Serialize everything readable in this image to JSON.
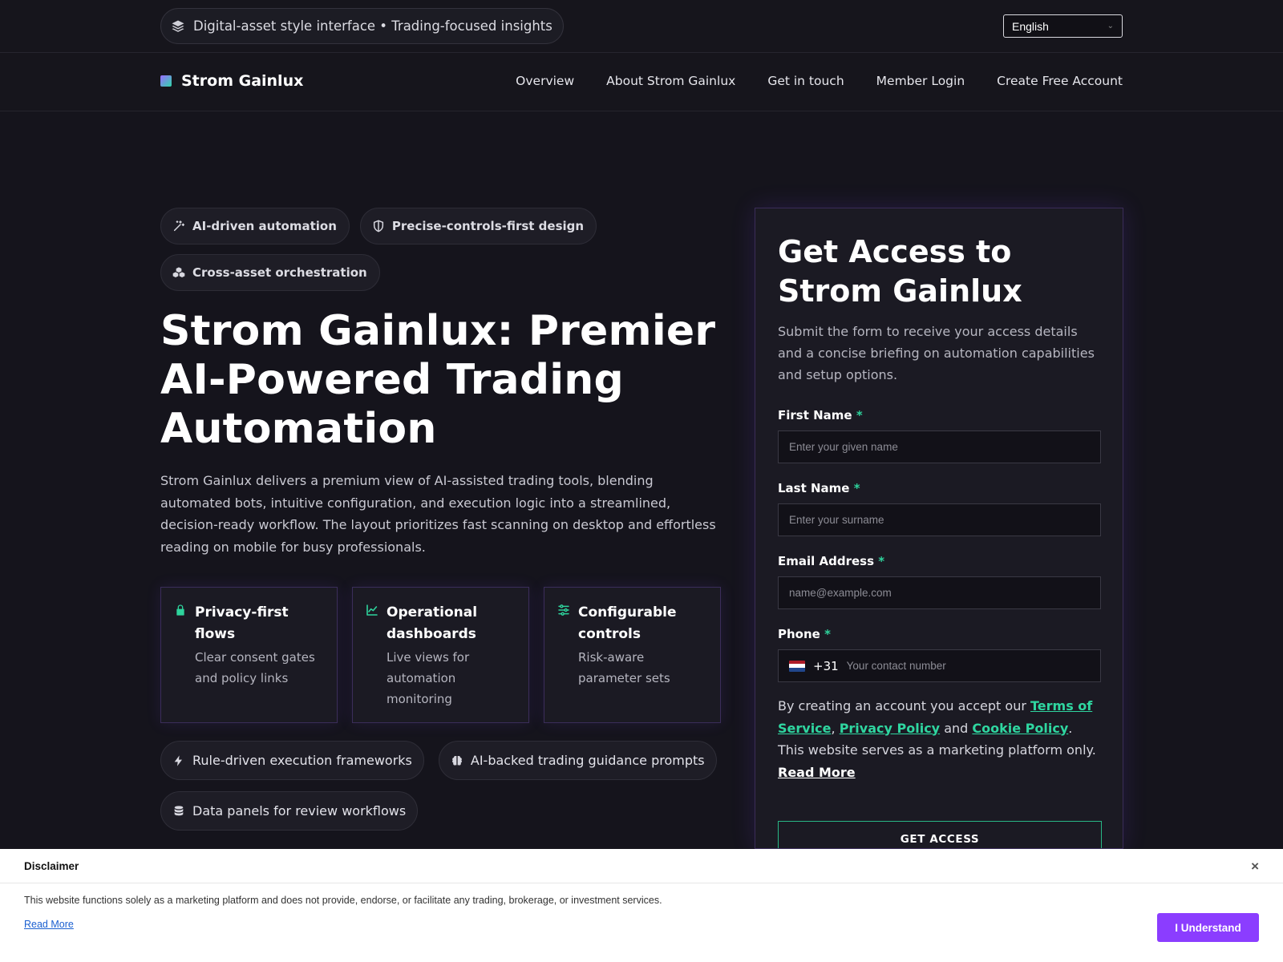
{
  "topbar": {
    "pill_text": "Digital-asset style interface • Trading-focused insights",
    "language": "English"
  },
  "nav": {
    "brand": "Strom Gainlux",
    "links": [
      "Overview",
      "About Strom Gainlux",
      "Get in touch",
      "Member Login",
      "Create Free Account"
    ]
  },
  "hero": {
    "tags": [
      "AI-driven automation",
      "Precise-controls-first design",
      "Cross-asset orchestration"
    ],
    "title": "Strom Gainlux: Premier AI-Powered Trading Automation",
    "description": "Strom Gainlux delivers a premium view of AI-assisted trading tools, blending automated bots, intuitive configuration, and execution logic into a streamlined, decision-ready workflow. The layout prioritizes fast scanning on desktop and effortless reading on mobile for busy professionals.",
    "features": [
      {
        "title": "Privacy-first flows",
        "text": "Clear consent gates and policy links",
        "icon": "lock-icon"
      },
      {
        "title": "Operational dashboards",
        "text": "Live views for automation monitoring",
        "icon": "chart-line-icon"
      },
      {
        "title": "Configurable controls",
        "text": "Risk-aware parameter sets",
        "icon": "sliders-icon"
      }
    ],
    "chips": [
      "Rule-driven execution frameworks",
      "AI-backed trading guidance prompts",
      "Data panels for review workflows"
    ]
  },
  "form": {
    "title": "Get Access to Strom Gainlux",
    "subtitle": "Submit the form to receive your access details and a concise briefing on automation capabilities and setup options.",
    "first_name_label": "First Name",
    "first_name_placeholder": "Enter your given name",
    "last_name_label": "Last Name",
    "last_name_placeholder": "Enter your surname",
    "email_label": "Email Address",
    "email_placeholder": "name@example.com",
    "phone_label": "Phone",
    "phone_code": "+31",
    "phone_placeholder": "Your contact number",
    "required_mark": "*",
    "consent_prefix": "By creating an account you accept our ",
    "terms": "Terms of Service",
    "comma": ", ",
    "privacy": "Privacy Policy",
    "and": " and ",
    "cookie": "Cookie Policy",
    "consent_suffix": ". This website serves as a marketing platform only. ",
    "read_more": "Read More",
    "submit": "GET ACCESS"
  },
  "disclaimer": {
    "title": "Disclaimer",
    "text": "This website functions solely as a marketing platform and does not provide, endorse, or facilitate any trading, brokerage, or investment services.",
    "read_more": "Read More",
    "button": "I Understand",
    "close": "×"
  },
  "colors": {
    "accent_green": "#2ed39c",
    "accent_purple": "#8b3dff",
    "background": "#15141c"
  }
}
